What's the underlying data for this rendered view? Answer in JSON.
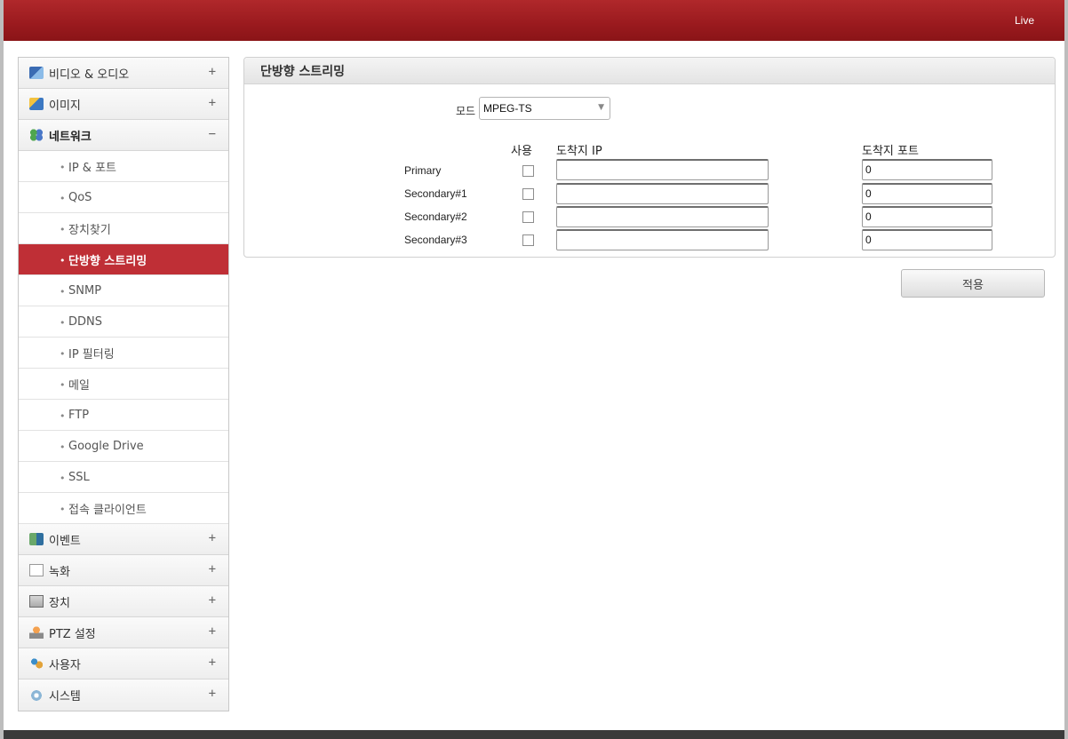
{
  "header": {
    "live_label": "Live"
  },
  "sidebar": {
    "menus_top": [
      {
        "label": "비디오 & 오디오",
        "toggle": "+",
        "icon": "video-audio-icon"
      },
      {
        "label": "이미지",
        "toggle": "+",
        "icon": "image-icon"
      },
      {
        "label": "네트워크",
        "toggle": "−",
        "icon": "network-icon"
      }
    ],
    "network_items": [
      {
        "label": "IP & 포트"
      },
      {
        "label": "QoS"
      },
      {
        "label": "장치찾기"
      },
      {
        "label": "단방향 스트리밍",
        "active": true
      },
      {
        "label": "SNMP"
      },
      {
        "label": "DDNS"
      },
      {
        "label": "IP 필터링"
      },
      {
        "label": "메일"
      },
      {
        "label": "FTP"
      },
      {
        "label": "Google Drive"
      },
      {
        "label": "SSL"
      },
      {
        "label": "접속 클라이언트"
      }
    ],
    "bullet": "•",
    "menus_bottom": [
      {
        "label": "이벤트",
        "toggle": "+",
        "icon": "event-icon"
      },
      {
        "label": "녹화",
        "toggle": "+",
        "icon": "record-icon"
      },
      {
        "label": "장치",
        "toggle": "+",
        "icon": "device-icon"
      },
      {
        "label": "PTZ 설정",
        "toggle": "+",
        "icon": "ptz-icon"
      },
      {
        "label": "사용자",
        "toggle": "+",
        "icon": "user-icon"
      },
      {
        "label": "시스템",
        "toggle": "+",
        "icon": "system-icon"
      }
    ]
  },
  "panel": {
    "title": "단방향 스트리밍",
    "mode_label": "모드",
    "mode_value": "MPEG-TS",
    "mode_arrow": "▼",
    "col_use": "사용",
    "col_ip": "도착지 IP",
    "col_port": "도착지 포트",
    "rows": [
      {
        "label": "Primary",
        "checked": false,
        "ip": "",
        "port": "0"
      },
      {
        "label": "Secondary#1",
        "checked": false,
        "ip": "",
        "port": "0"
      },
      {
        "label": "Secondary#2",
        "checked": false,
        "ip": "",
        "port": "0"
      },
      {
        "label": "Secondary#3",
        "checked": false,
        "ip": "",
        "port": "0"
      }
    ]
  },
  "actions": {
    "apply_label": "적용"
  },
  "colors": {
    "header_red": "#9a1a1e",
    "active_item": "#bf2f36",
    "footer": "#3a3a3a"
  }
}
